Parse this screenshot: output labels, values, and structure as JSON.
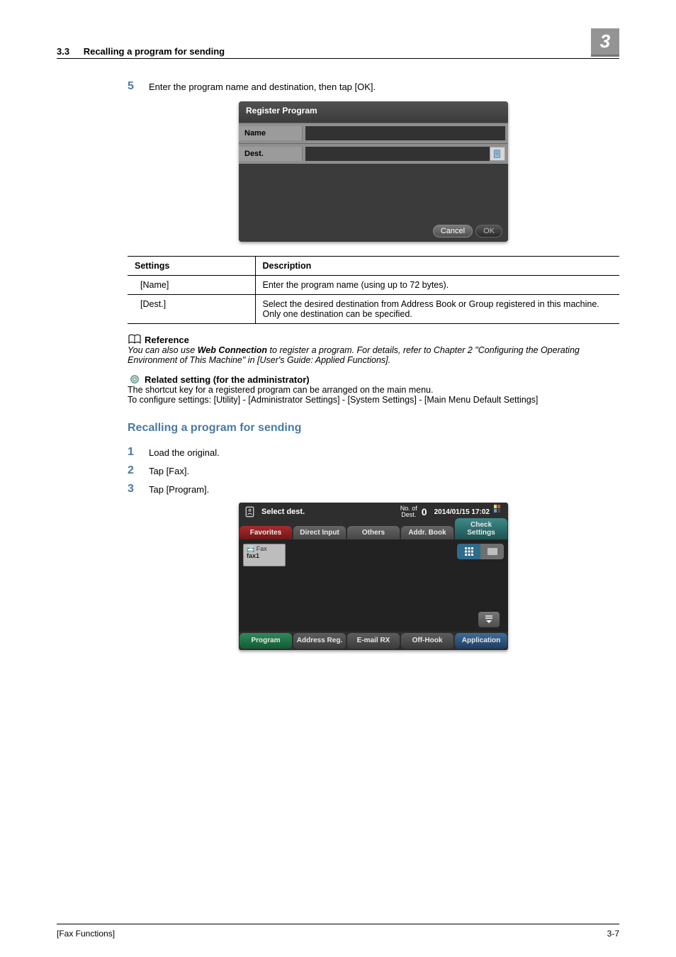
{
  "header": {
    "section_number": "3.3",
    "section_title": "Recalling a program for sending",
    "chapter_badge": "3"
  },
  "step5": {
    "num": "5",
    "text": "Enter the program name and destination, then tap [OK]."
  },
  "shot1": {
    "title": "Register Program",
    "name_label": "Name",
    "dest_label": "Dest.",
    "cancel": "Cancel",
    "ok": "OK"
  },
  "settings_table": {
    "head_settings": "Settings",
    "head_description": "Description",
    "rows": [
      {
        "setting": "[Name]",
        "desc": "Enter the program name (using up to 72 bytes)."
      },
      {
        "setting": "[Dest.]",
        "desc": "Select the desired destination from Address Book or Group registered in this machine. Only one destination can be specified."
      }
    ]
  },
  "reference": {
    "heading": "Reference",
    "pre": "You can also use ",
    "bold": "Web Connection",
    "post": " to register a program. For details, refer to Chapter 2 \"Configuring the Operating Environment of This Machine\" in [User's Guide: Applied Functions]."
  },
  "related": {
    "heading": "Related setting (for the administrator)",
    "line1": "The shortcut key for a registered program can be arranged on the main menu.",
    "line2": "To configure settings: [Utility] - [Administrator Settings] - [System Settings] - [Main Menu Default Settings]"
  },
  "section_heading": "Recalling a program for sending",
  "steps": [
    {
      "num": "1",
      "text": "Load the original."
    },
    {
      "num": "2",
      "text": "Tap [Fax]."
    },
    {
      "num": "3",
      "text": "Tap [Program]."
    }
  ],
  "shot2": {
    "title": "Select dest.",
    "no_of_dest_label": "No. of\nDest.",
    "no_of_dest_value": "0",
    "timestamp": "2014/01/15 17:02",
    "tabs": {
      "favorites": "Favorites",
      "direct_input": "Direct Input",
      "others": "Others",
      "addr_book": "Addr. Book",
      "check_settings": "Check Settings"
    },
    "fax_tile_line1": "Fax",
    "fax_tile_line2": "fax1",
    "bottom": {
      "program": "Program",
      "address_reg": "Address Reg.",
      "email_rx": "E-mail RX",
      "off_hook": "Off-Hook",
      "application": "Application"
    }
  },
  "footer": {
    "left": "[Fax Functions]",
    "right": "3-7"
  }
}
